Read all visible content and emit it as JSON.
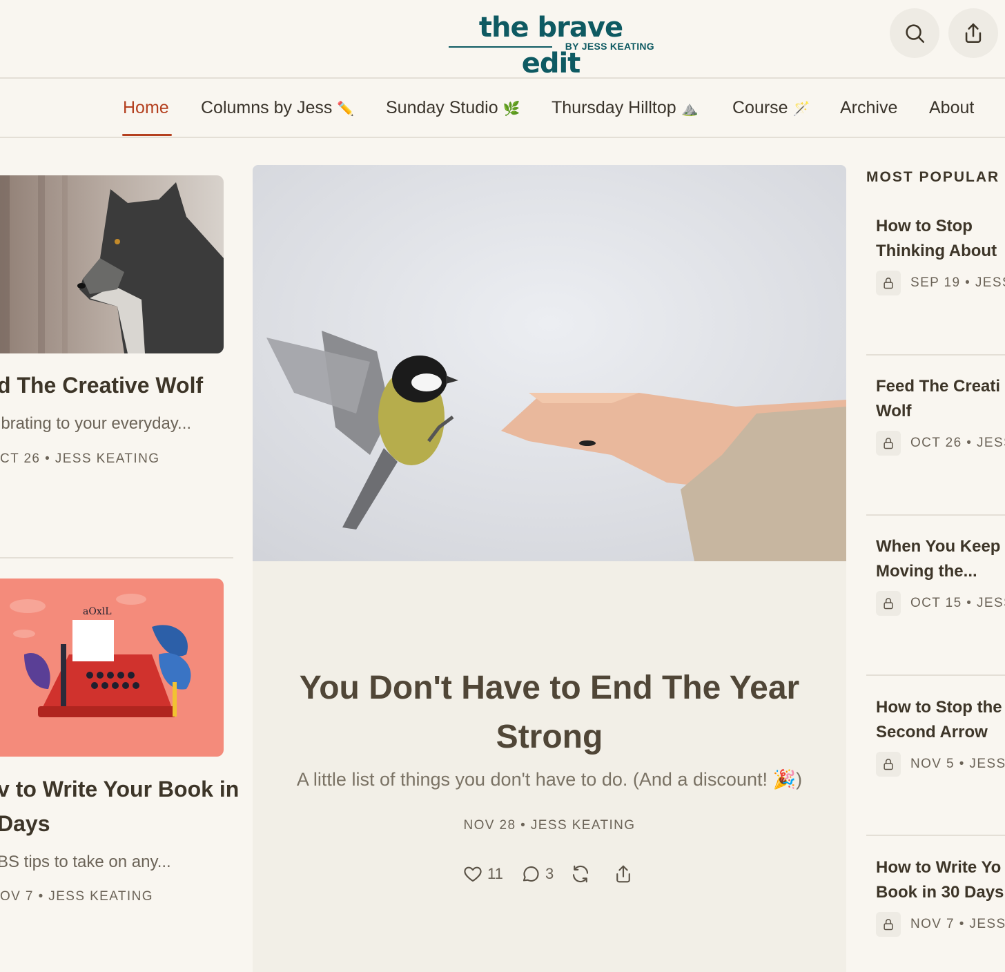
{
  "header": {
    "logo_main": "the brave edit",
    "logo_sub": "BY JESS KEATING"
  },
  "nav": {
    "items": [
      {
        "label": "Home",
        "emoji": ""
      },
      {
        "label": "Columns by Jess",
        "emoji": "✏️"
      },
      {
        "label": "Sunday Studio",
        "emoji": "🌿"
      },
      {
        "label": "Thursday Hilltop",
        "emoji": "⛰️"
      },
      {
        "label": "Course",
        "emoji": "🪄"
      },
      {
        "label": "Archive",
        "emoji": ""
      },
      {
        "label": "About",
        "emoji": ""
      }
    ],
    "active": "Home"
  },
  "left_posts": [
    {
      "title": "d The Creative Wolf",
      "subtitle": "ibrating to your everyday...",
      "meta": "CT 26 • JESS KEATING"
    },
    {
      "title_line1": "v to Write Your Book in",
      "title_line2": "Days",
      "subtitle": "BS tips to take on any...",
      "meta": "OV 7 • JESS KEATING"
    }
  ],
  "feature": {
    "title": "You Don't Have to End The Year Strong",
    "subtitle": "A little list of things you don't have to do. (And a discount! 🎉)",
    "meta": "NOV 28 • JESS KEATING",
    "likes": "11",
    "comments": "3"
  },
  "most_popular": {
    "heading": "MOST POPULAR",
    "items": [
      {
        "line1": "How to Stop",
        "line2": "Thinking About",
        "meta": "SEP 19 • JESS"
      },
      {
        "line1": "Feed The Creati",
        "line2": "Wolf",
        "meta": "OCT 26 • JESS"
      },
      {
        "line1": "When You Keep",
        "line2": "Moving the...",
        "meta": "OCT 15 • JESS"
      },
      {
        "line1": "How to Stop the",
        "line2": "Second Arrow",
        "meta": "NOV 5 • JESS."
      },
      {
        "line1": "How to Write Yo",
        "line2": "Book in 30 Days",
        "meta": "NOV 7 • JESS."
      }
    ]
  },
  "colors": {
    "background": "#f9f6f0",
    "brand": "#0e5a62",
    "accent": "#b4401f",
    "card": "#f2efe7"
  }
}
